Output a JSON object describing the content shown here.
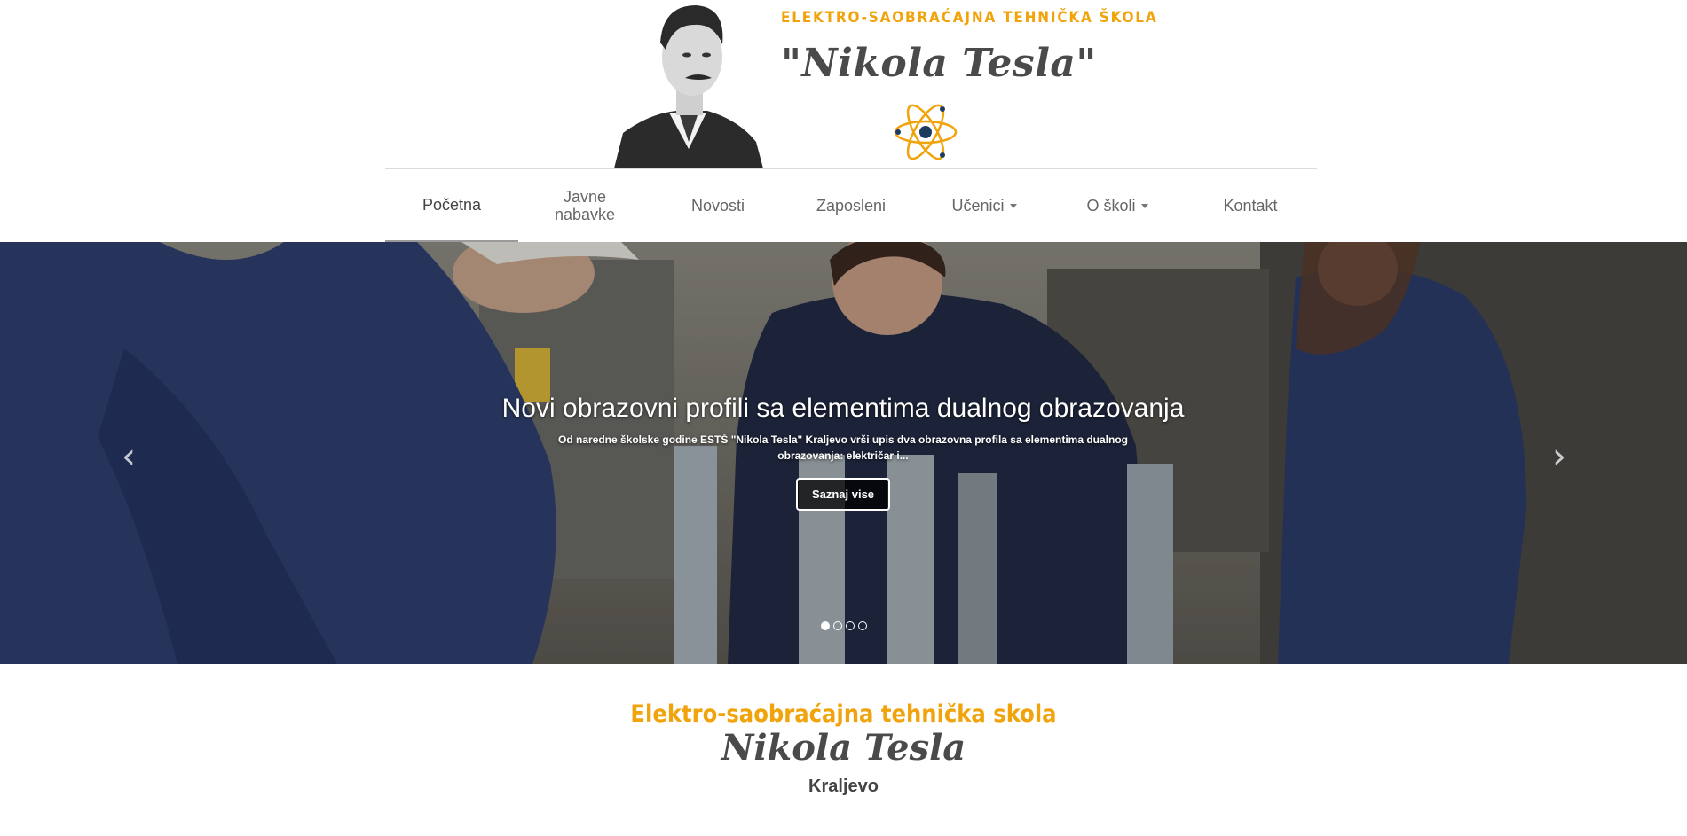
{
  "header": {
    "school_line": "ELEKTRO-SAOBRAĆAJNA TEHNIČKA ŠKOLA",
    "school_name": "\"Nikola Tesla\"",
    "logo_icon": "atom-icon",
    "portrait": "tesla-portrait"
  },
  "nav": {
    "items": [
      {
        "label": "Početna",
        "active": true
      },
      {
        "label": "Javne nabavke"
      },
      {
        "label": "Novosti"
      },
      {
        "label": "Zaposleni"
      },
      {
        "label": "Učenici",
        "dropdown": true
      },
      {
        "label": "O školi",
        "dropdown": true
      },
      {
        "label": "Kontakt"
      }
    ]
  },
  "carousel": {
    "title": "Novi obrazovni profili sa elementima dualnog obrazovanja",
    "text": "Od naredne školske godine ESTŠ \"Nikola Tesla\" Kraljevo vrši upis dva obrazovna profila sa elementima dualnog obrazovanja: električar i...",
    "button_label": "Saznaj vise",
    "prev_icon": "chevron-left-icon",
    "next_icon": "chevron-right-icon",
    "slide_count": 4,
    "active_slide": 1
  },
  "footer_title": {
    "line1": "Elektro-saobraćajna tehnička skola",
    "line2": "Nikola Tesla",
    "line3": "Kraljevo"
  },
  "colors": {
    "accent": "#f0a30a",
    "dark_text": "#4a4a4a"
  }
}
